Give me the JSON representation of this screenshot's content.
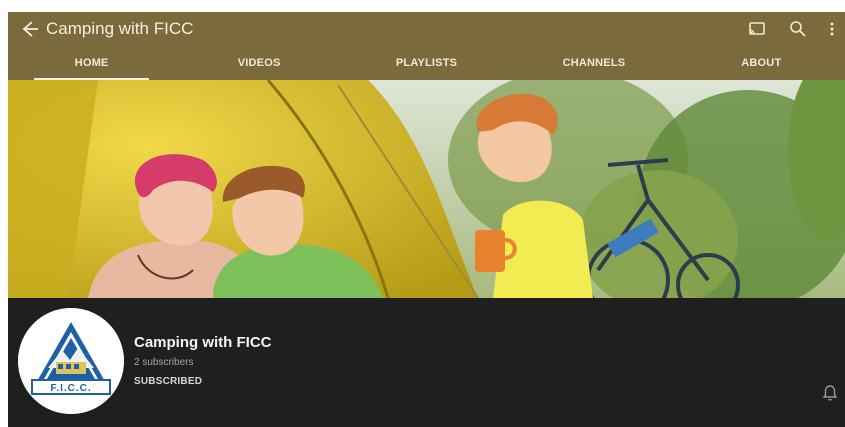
{
  "appbar": {
    "title": "Camping with FICC",
    "icons": {
      "back": "arrow-left-icon",
      "cast": "cast-icon",
      "search": "search-icon",
      "more": "more-vertical-icon"
    },
    "color": "#7b6a3b"
  },
  "tabs": [
    {
      "label": "HOME",
      "active": true
    },
    {
      "label": "VIDEOS",
      "active": false
    },
    {
      "label": "PLAYLISTS",
      "active": false
    },
    {
      "label": "CHANNELS",
      "active": false
    },
    {
      "label": "ABOUT",
      "active": false
    }
  ],
  "banner": {
    "icon": "channel-banner-photo"
  },
  "channel": {
    "name": "Camping with FICC",
    "subscribers": "2 subscribers",
    "subscribe_state": "SUBSCRIBED",
    "notification_icon": "bell-icon",
    "avatar": {
      "logo_text": "F.I.C.C.",
      "brand_color": "#1f5fa8"
    }
  }
}
